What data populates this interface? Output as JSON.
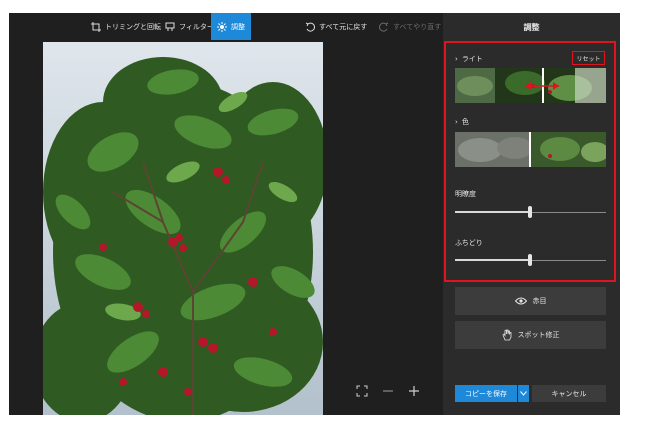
{
  "toolbar": {
    "crop_label": "トリミングと回転",
    "filter_label": "フィルター",
    "adjust_label": "調整",
    "undo_all_label": "すべて元に戻す",
    "redo_all_label": "すべてやり直す"
  },
  "panel": {
    "title": "調整",
    "light_label": "ライト",
    "reset_label": "リセット",
    "color_label": "色",
    "clarity_label": "明瞭度",
    "clarity_value": 0.5,
    "vignette_label": "ふちどり",
    "vignette_value": 0.5,
    "redeye_label": "赤目",
    "spot_fix_label": "スポット修正",
    "save_copy_label": "コピーを保存",
    "cancel_label": "キャンセル"
  },
  "colors": {
    "accent": "#1e88d9",
    "highlight": "#e0141e",
    "panel_bg": "#2b2b2b",
    "app_bg": "#1f1f1f"
  },
  "icons": [
    "crop-rotate-icon",
    "filter-icon",
    "brightness-icon",
    "undo-icon",
    "redo-icon",
    "chevron-right-icon",
    "eye-icon",
    "hand-icon",
    "chevron-down-icon",
    "fit-screen-icon",
    "zoom-out-icon",
    "zoom-in-icon"
  ]
}
